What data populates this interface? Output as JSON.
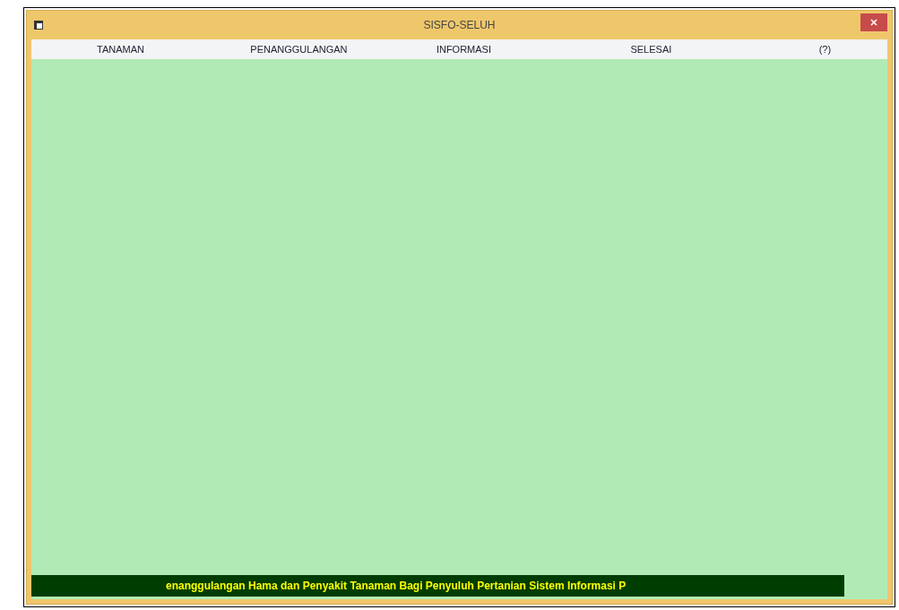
{
  "window": {
    "title": "SISFO-SELUH"
  },
  "menu": [
    {
      "label": "TANAMAN"
    },
    {
      "label": "PENANGGULANGAN"
    },
    {
      "label": "INFORMASI"
    },
    {
      "label": "SELESAI"
    },
    {
      "label": "(?)"
    }
  ],
  "marquee": "enanggulangan Hama dan Penyakit Tanaman Bagi Penyuluh Pertanian  Sistem Informasi P"
}
